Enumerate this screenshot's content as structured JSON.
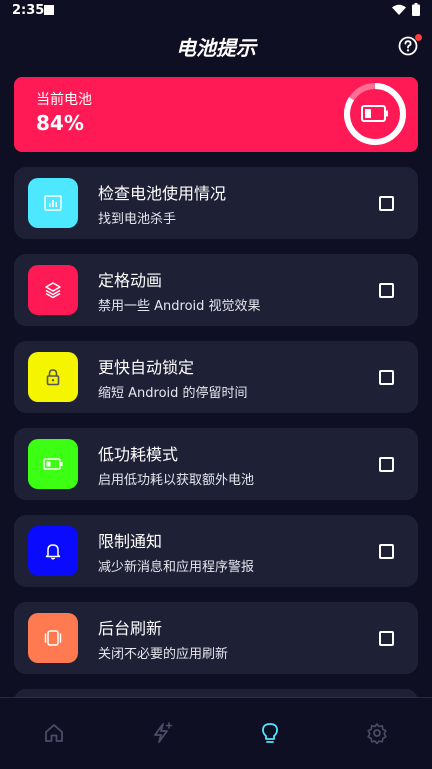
{
  "status_bar": {
    "time": "2:35"
  },
  "header": {
    "title": "电池提示",
    "help_icon": "help-circle-icon"
  },
  "battery": {
    "label": "当前电池",
    "percent_text": "84%",
    "level": 0.84,
    "accent": "#ff1a55"
  },
  "tasks": [
    {
      "title": "检查电池使用情况",
      "subtitle": "找到电池杀手",
      "icon": "bar-chart-icon",
      "color": "#4de8ff"
    },
    {
      "title": "定格动画",
      "subtitle": "禁用一些 Android 视觉效果",
      "icon": "layers-icon",
      "color": "#ff1a55"
    },
    {
      "title": "更快自动锁定",
      "subtitle": "缩短 Android 的停留时间",
      "icon": "lock-icon",
      "color": "#f5f500"
    },
    {
      "title": "低功耗模式",
      "subtitle": "启用低功耗以获取额外电池",
      "icon": "battery-icon",
      "color": "#3cff14"
    },
    {
      "title": "限制通知",
      "subtitle": "减少新消息和应用程序警报",
      "icon": "bell-icon",
      "color": "#0a0aff"
    },
    {
      "title": "后台刷新",
      "subtitle": "关闭不必要的应用刷新",
      "icon": "refresh-icon",
      "color": "#ff7a50"
    }
  ],
  "bottom_nav": [
    {
      "name": "home-icon",
      "active": false
    },
    {
      "name": "sparkle-icon",
      "active": false
    },
    {
      "name": "lightbulb-icon",
      "active": true
    },
    {
      "name": "gear-icon",
      "active": false
    }
  ],
  "colors": {
    "background": "#0e0f22",
    "card": "#1e2035",
    "nav_active": "#4de8ff",
    "nav_inactive": "#4a4d66"
  }
}
